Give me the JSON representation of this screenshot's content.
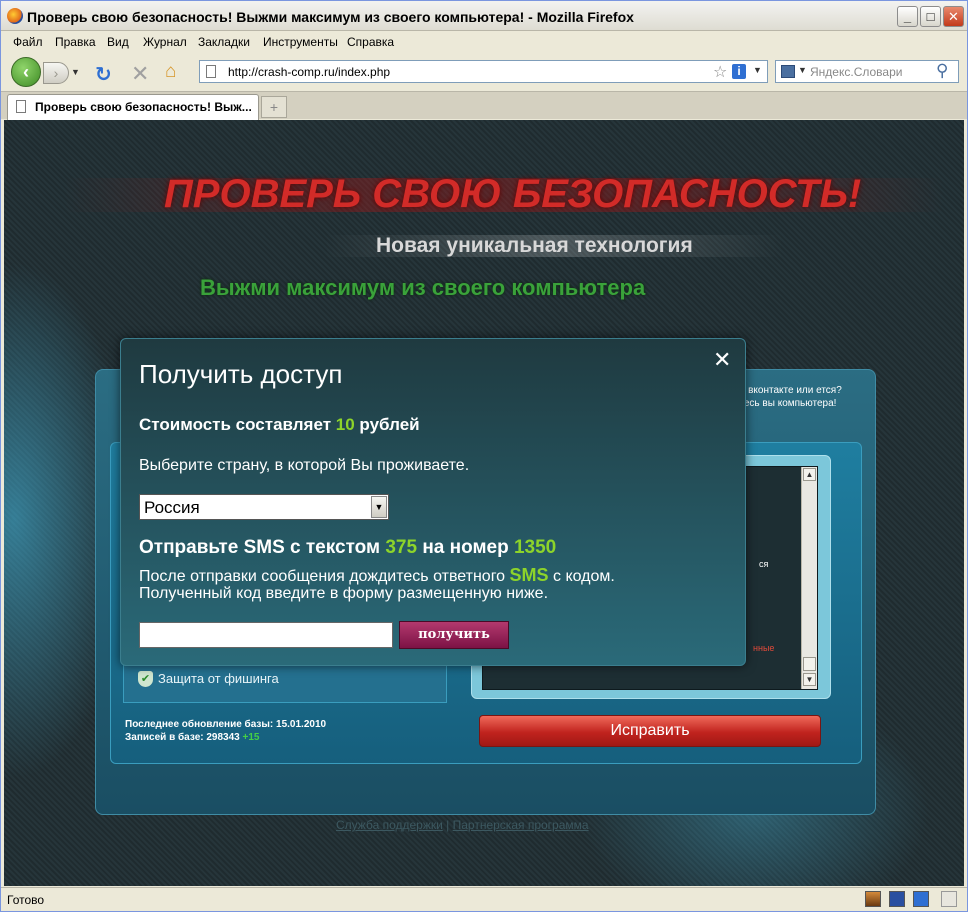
{
  "window": {
    "title": "Проверь свою безопасность! Выжми максимум из своего компьютера! - Mozilla Firefox"
  },
  "menu": [
    "Файл",
    "Правка",
    "Вид",
    "Журнал",
    "Закладки",
    "Инструменты",
    "Справка"
  ],
  "nav": {
    "url": "http://crash-comp.ru/index.php",
    "search_placeholder": "Яндекс.Словари"
  },
  "tab": {
    "title": "Проверь свою безопасность! Выж..."
  },
  "page": {
    "headline": "ПРОВЕРЬ СВОЮ БЕЗОПАСНОСТЬ!",
    "sub1": "Новая уникальная технология",
    "sub2": "Выжми максимум из своего компьютера",
    "panel_text": "ах, вконтакте или ется? Здесь вы компьютера!",
    "phishing": "Защита от фишинга",
    "last_update": "Последнее обновление базы: 15.01.2010",
    "records": "Записей в базе: 298343",
    "records_plus": "+15",
    "scan_frag1": "ся",
    "scan_frag2": "нные",
    "fix_button": "Исправить",
    "footer_support": "Служба поддержки",
    "footer_sep": "|",
    "footer_partner": "Партнерская программа"
  },
  "dialog": {
    "title": "Получить доступ",
    "cost_prefix": "Стоимость составляет",
    "cost_value": "10",
    "cost_suffix": "рублей",
    "choose_country": "Выберите страну, в которой Вы проживаете.",
    "country": "Россия",
    "sms_prefix": "Отправьте SMS с текстом",
    "sms_text": "375",
    "sms_mid": "на номер",
    "sms_number": "1350",
    "after_prefix": "После отправки сообщения дождитесь ответного",
    "after_sms": "SMS",
    "after_suffix": "с кодом.",
    "after_line2": "Полученный код введите в форму размещенную ниже.",
    "get_button": "получить",
    "code_value": ""
  },
  "status": {
    "text": "Готово"
  }
}
